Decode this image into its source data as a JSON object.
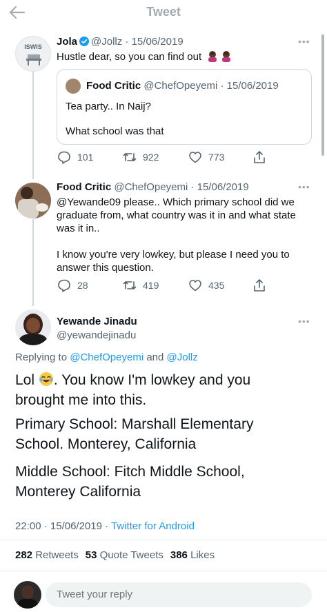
{
  "header": {
    "title": "Tweet",
    "back_icon": "arrow-left-icon"
  },
  "quoting_tweet": {
    "name": "Jola",
    "handle": "@Jollz",
    "date": "15/06/2019",
    "text": "Hustle dear, so you can find out",
    "avatar_text": "ISWIS",
    "quote": {
      "name": "Food Critic",
      "handle": "@ChefOpeyemi",
      "date": "15/06/2019",
      "lines": [
        "Tea party.. In Naij?",
        "",
        "What school was that"
      ]
    },
    "actions": {
      "replies": "101",
      "retweets": "922",
      "likes": "773"
    }
  },
  "reply_tweet": {
    "name": "Food Critic",
    "handle": "@ChefOpeyemi",
    "date": "15/06/2019",
    "lines": [
      "@Yewande09 please.. Which primary school did we",
      "graduate from, what country was it in and what state",
      "was it in..",
      "",
      "I know you're very lowkey, but please I need you to",
      "answer this question."
    ],
    "actions": {
      "replies": "28",
      "retweets": "419",
      "likes": "435"
    }
  },
  "main_tweet": {
    "name": "Yewande Jinadu",
    "handle": "@yewandejinadu",
    "replying_prefix": "Replying to",
    "replying_to_1": "@ChefOpeyemi",
    "replying_and": "and",
    "replying_to_2": "@Jollz",
    "line1_a": "Lol",
    "line1_b": ". You know I'm lowkey and you",
    "line2": "brought me into this.",
    "line3": "Primary School: Marshall Elementary",
    "line4": "School. Monterey, California",
    "line5": "Middle School: Fitch Middle School,",
    "line6": "Monterey California",
    "time": "22:00",
    "date": "15/06/2019",
    "source": "Twitter for Android",
    "retweets_count": "282",
    "retweets_label": "Retweets",
    "quotes_count": "53",
    "quotes_label": "Quote Tweets",
    "likes_count": "386",
    "likes_label": "Likes"
  },
  "reply_bar": {
    "placeholder": "Tweet your reply"
  },
  "colors": {
    "accent": "#1d9bf0",
    "muted": "#536471",
    "text": "#0f1419",
    "border": "#cfd9de"
  }
}
